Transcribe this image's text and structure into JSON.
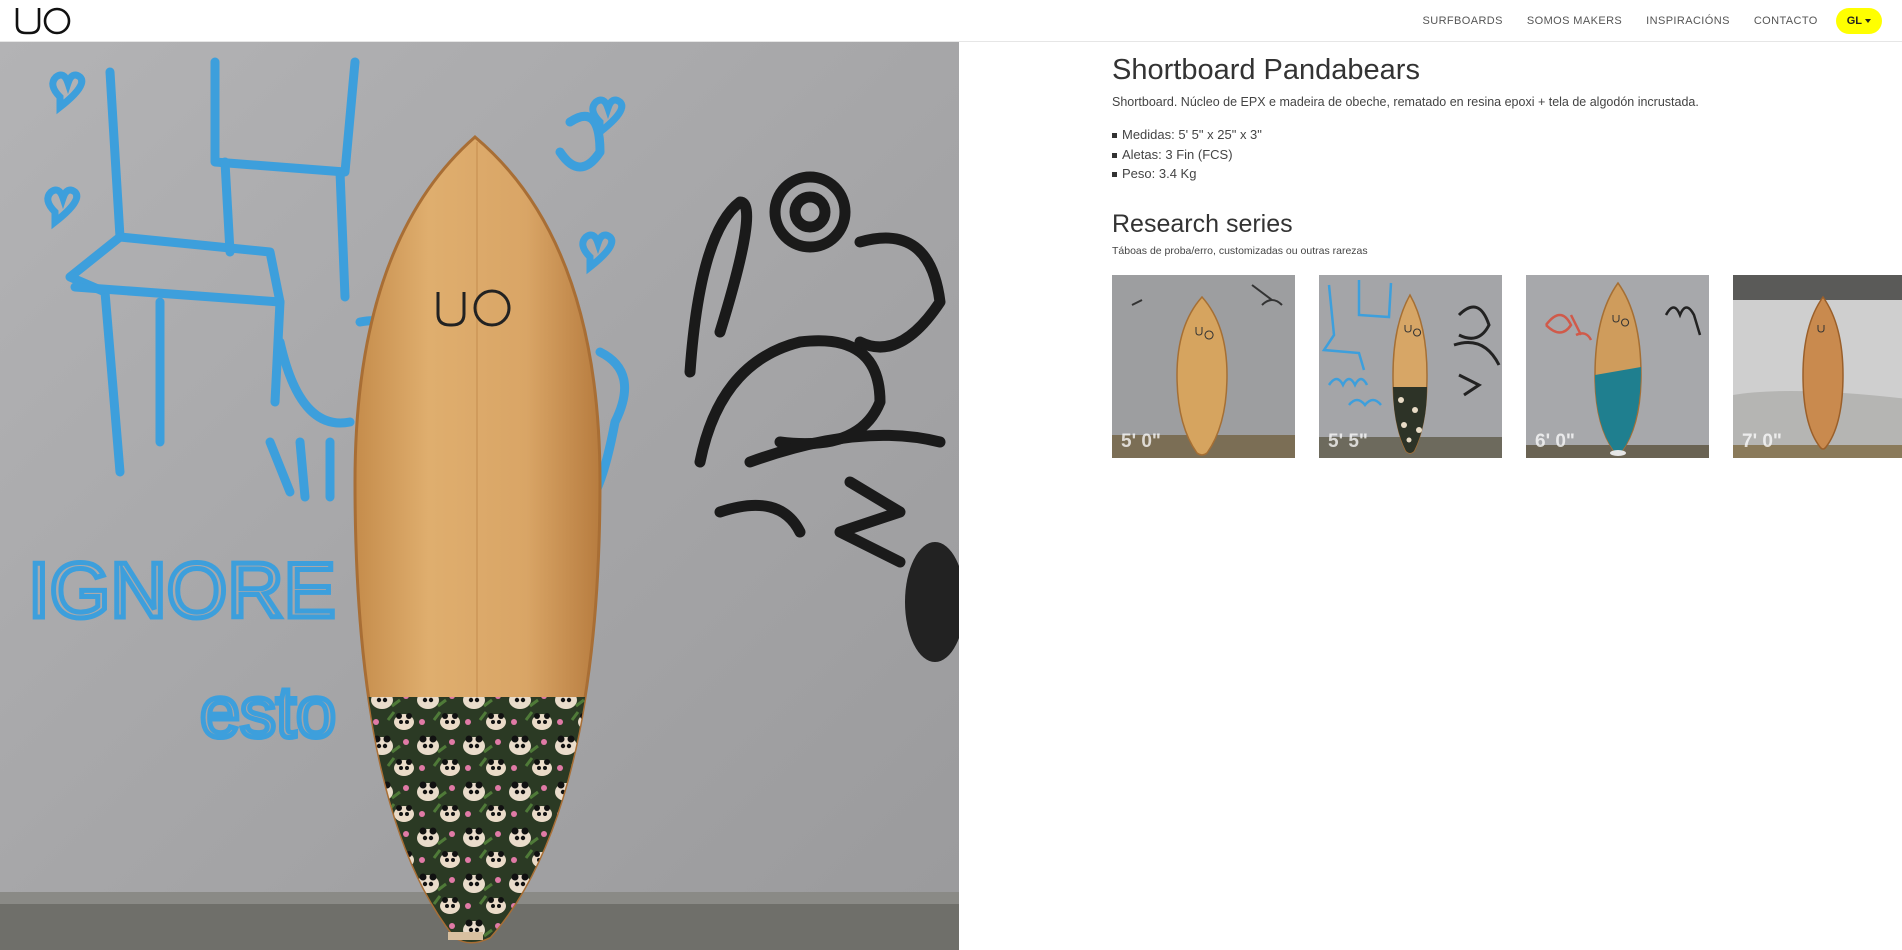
{
  "header": {
    "logo_alt": "UO",
    "nav": [
      "SURFBOARDS",
      "SOMOS MAKERS",
      "INSPIRACIÓNS",
      "CONTACTO"
    ],
    "language": "GL"
  },
  "hero": {
    "graffiti_text_1": "IGNORE",
    "graffiti_text_2": "esto",
    "board_logo": "UO"
  },
  "product": {
    "title": "Shortboard Pandabears",
    "description": "Shortboard. Núcleo de EPX e madeira de obeche, rematado en resina epoxi + tela de algodón incrustada.",
    "specs": [
      "Medidas: 5' 5\" x 25\" x 3\"",
      "Aletas: 3 Fin (FCS)",
      "Peso: 3.4 Kg"
    ]
  },
  "series": {
    "title": "Research series",
    "subtitle": "Táboas de proba/erro, customizadas ou outras rarezas",
    "items": [
      {
        "label": "5' 0\""
      },
      {
        "label": "5' 5\""
      },
      {
        "label": "6' 0\""
      },
      {
        "label": "7' 0\""
      }
    ]
  },
  "colors": {
    "accent": "#ffff00",
    "wall": "#a9a9ab",
    "graffiti_blue": "#3d9fdc",
    "wood": "#d8a868"
  }
}
